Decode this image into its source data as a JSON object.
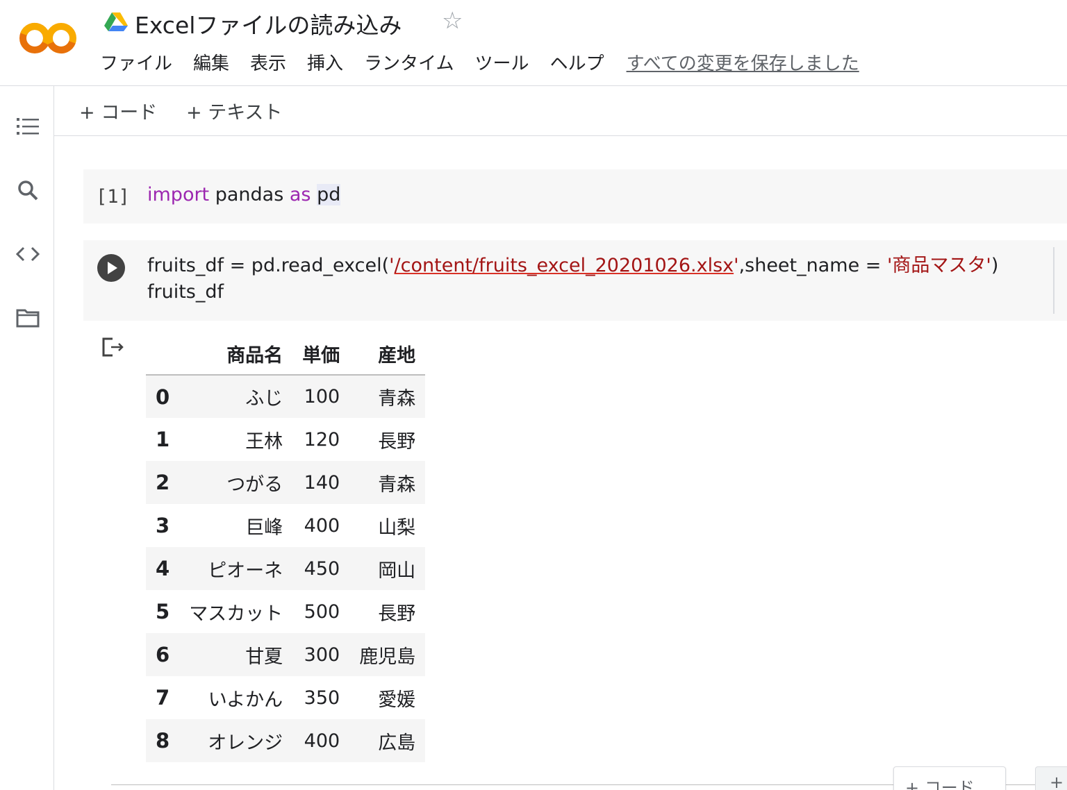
{
  "header": {
    "title": "Excelファイルの読み込み",
    "menu": [
      "ファイル",
      "編集",
      "表示",
      "挿入",
      "ランタイム",
      "ツール",
      "ヘルプ"
    ],
    "save_status": "すべての変更を保存しました"
  },
  "toolbar": {
    "add_code": "+ コード",
    "add_text": "+ テキスト"
  },
  "cells": [
    {
      "exec_count": "[1]",
      "code": {
        "kw1": "import",
        "t1": " pandas ",
        "kw2": "as",
        "t2": " ",
        "alias": "pd"
      }
    },
    {
      "code": {
        "pre": "fruits_df = pd.read_excel(",
        "q1": "'",
        "path": "/content/fruits_excel_20201026.xlsx",
        "q2": "'",
        "mid": ",sheet_name = ",
        "sheet": "'商品マスタ'",
        "post": ")",
        "line2": "fruits_df"
      }
    }
  ],
  "output": {
    "columns": [
      "",
      "商品名",
      "単価",
      "産地"
    ],
    "rows": [
      [
        "0",
        "ふじ",
        "100",
        "青森"
      ],
      [
        "1",
        "王林",
        "120",
        "長野"
      ],
      [
        "2",
        "つがる",
        "140",
        "青森"
      ],
      [
        "3",
        "巨峰",
        "400",
        "山梨"
      ],
      [
        "4",
        "ピオーネ",
        "450",
        "岡山"
      ],
      [
        "5",
        "マスカット",
        "500",
        "長野"
      ],
      [
        "6",
        "甘夏",
        "300",
        "鹿児島"
      ],
      [
        "7",
        "いよかん",
        "350",
        "愛媛"
      ],
      [
        "8",
        "オレンジ",
        "400",
        "広島"
      ]
    ]
  },
  "bottom": {
    "add_code": "+ コード",
    "add_text": "+"
  },
  "colors": {
    "keyword": "#9c27b0",
    "string": "#a31515",
    "logo_orange": "#f9ab00",
    "logo_dark_orange": "#e8710a"
  },
  "icons": [
    "colab-logo",
    "drive-icon",
    "star-icon",
    "toc-icon",
    "search-icon",
    "code-snippets-icon",
    "folder-icon",
    "run-icon",
    "output-icon"
  ]
}
